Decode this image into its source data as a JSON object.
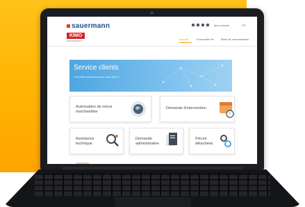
{
  "site": {
    "brand": "sauermann",
    "secondary_brand": "KIMO",
    "secondary_brand_sub": "INSTRUMENTS",
    "header_links": [
      "Mon compte",
      "FR"
    ],
    "nav": [
      "Accueil",
      "Formulaire de",
      "Base de connaissance"
    ],
    "social_icons": [
      "linkedin-icon",
      "youtube-icon",
      "twitter-icon",
      "facebook-icon"
    ]
  },
  "banner": {
    "title": "Service clients",
    "subtitle": "Comment pouvons-nous vous aider ?"
  },
  "cards": [
    {
      "label": "Autorisation de retour marchandise",
      "icon": "globe-box-icon"
    },
    {
      "label": "Demande d'intervention",
      "icon": "calendar-clock-icon"
    },
    {
      "label": "Assistance technique",
      "icon": "magnifier-icon"
    },
    {
      "label": "Demande administrative",
      "icon": "documents-icon"
    },
    {
      "label": "Pièces détachées",
      "icon": "gears-icon"
    }
  ],
  "colors": {
    "background": "#ffb300",
    "accent": "#ff9e00",
    "banner": "#4ea6e0",
    "laptop": "#1c1d20"
  }
}
